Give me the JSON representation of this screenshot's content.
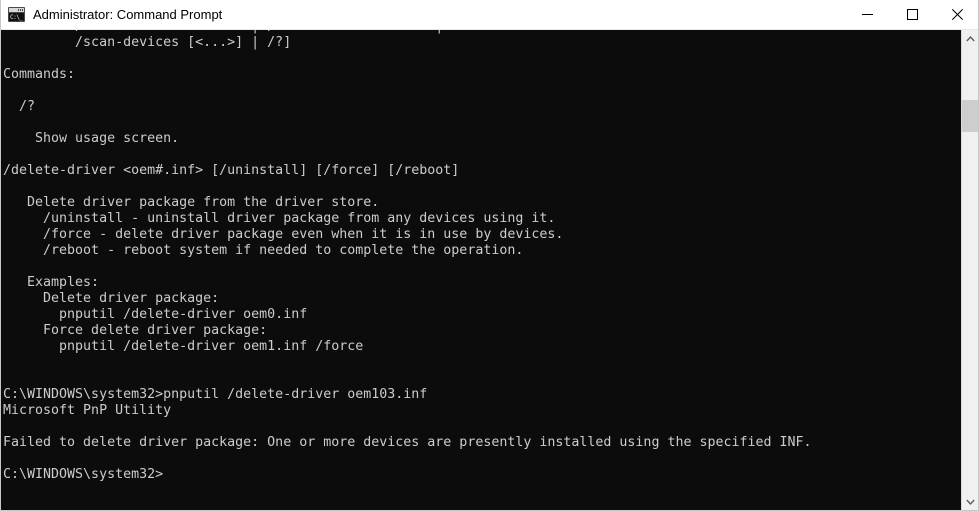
{
  "window": {
    "title": "Administrator: Command Prompt",
    "icon": "command-prompt-icon",
    "icon_glyph": "C:\\_",
    "controls": {
      "minimize": "Minimize",
      "maximize": "Maximize",
      "close": "Close"
    },
    "colors": {
      "titlebar_background": "#ffffff",
      "titlebar_text": "#000000",
      "console_background": "#0c0c0c",
      "console_text": "#cccccc",
      "scrollbar_track": "#f0f0f0",
      "scrollbar_thumb": "#cdcdcd",
      "close_hover": "#e81123"
    }
  },
  "console": {
    "lines": [
      "         /restart-device <...> | /remove-device <...> |",
      "         /scan-devices [<...>] | /?]",
      "",
      "Commands:",
      "",
      "  /?",
      "",
      "    Show usage screen.",
      "",
      "/delete-driver <oem#.inf> [/uninstall] [/force] [/reboot]",
      "",
      "   Delete driver package from the driver store.",
      "     /uninstall - uninstall driver package from any devices using it.",
      "     /force - delete driver package even when it is in use by devices.",
      "     /reboot - reboot system if needed to complete the operation.",
      "",
      "   Examples:",
      "     Delete driver package:",
      "       pnputil /delete-driver oem0.inf",
      "     Force delete driver package:",
      "       pnputil /delete-driver oem1.inf /force",
      "",
      "",
      "C:\\WINDOWS\\system32>pnputil /delete-driver oem103.inf",
      "Microsoft PnP Utility",
      "",
      "Failed to delete driver package: One or more devices are presently installed using the specified INF.",
      "",
      "C:\\WINDOWS\\system32>"
    ],
    "prompt": "C:\\WINDOWS\\system32>",
    "last_command": "pnputil /delete-driver oem103.inf",
    "program_name": "Microsoft PnP Utility",
    "error_message": "Failed to delete driver package: One or more devices are presently installed using the specified INF.",
    "cursor": "_"
  },
  "scrollbar": {
    "up_arrow": "scroll-up-arrow-icon",
    "down_arrow": "scroll-down-arrow-icon",
    "thumb": "scrollbar-thumb"
  }
}
